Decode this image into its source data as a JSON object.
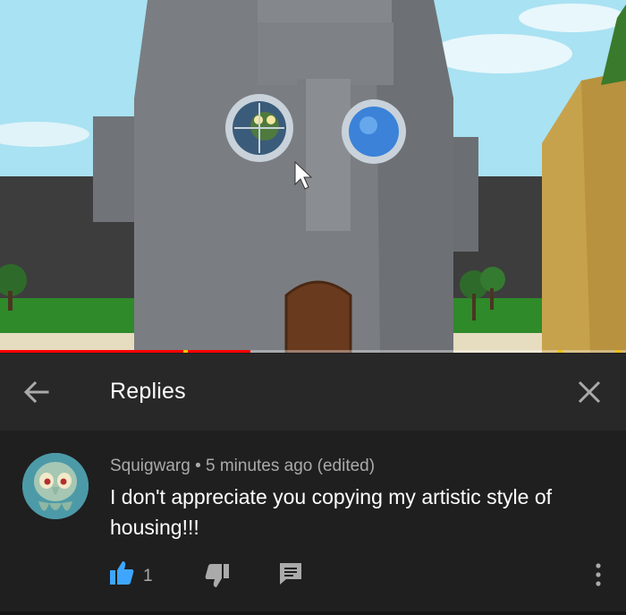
{
  "video": {
    "progress_fraction": 0.4,
    "progress_color": "#ff0000",
    "ad_marker_color": "#f2c200"
  },
  "header": {
    "title": "Replies",
    "back_icon": "arrow-left-icon",
    "close_icon": "close-icon"
  },
  "comment": {
    "author": "Squigwarg",
    "separator": "•",
    "time": "5 minutes ago (edited)",
    "text": "I don't appreciate you copying my artistic style of housing!!!",
    "like_count": "1",
    "like_active_color": "#3ea6ff",
    "icons": {
      "like": "thumbs-up-icon",
      "dislike": "thumbs-down-icon",
      "reply": "reply-comment-icon",
      "more": "more-vertical-icon"
    }
  }
}
